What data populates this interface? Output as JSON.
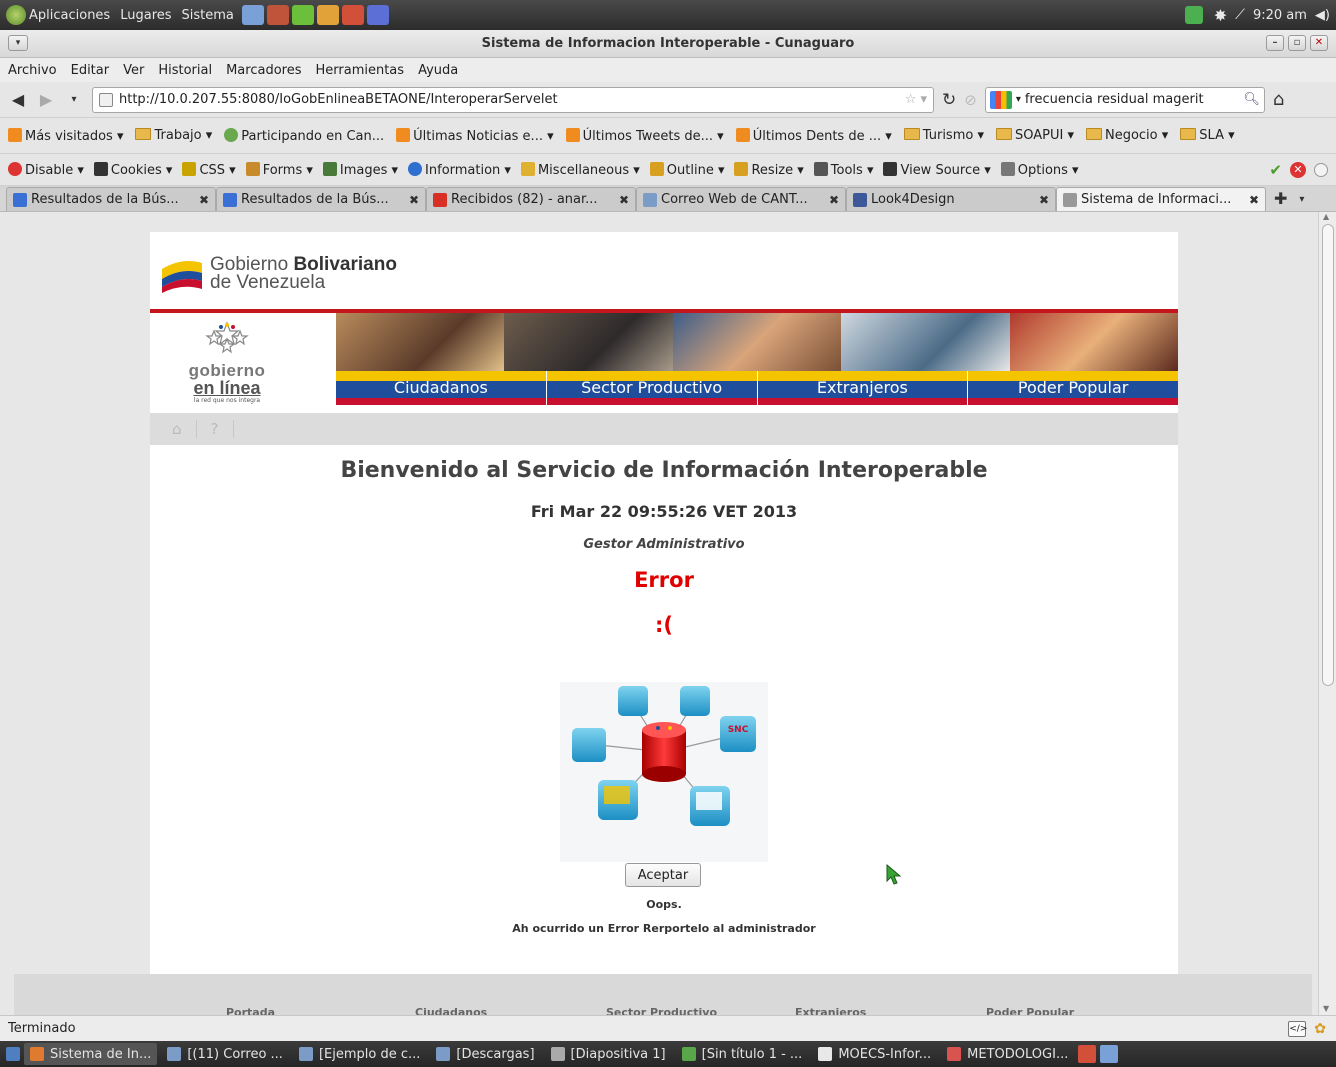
{
  "panel": {
    "menus": [
      "Aplicaciones",
      "Lugares",
      "Sistema"
    ],
    "clock": "9:20 am"
  },
  "window": {
    "title": "Sistema de Informacion Interoperable - Cunaguaro"
  },
  "menubar": [
    "Archivo",
    "Editar",
    "Ver",
    "Historial",
    "Marcadores",
    "Herramientas",
    "Ayuda"
  ],
  "navbar": {
    "url": "http://10.0.207.55:8080/IoGobEnlineaBETAONE/InteroperarServelet",
    "search": "frecuencia residual magerit"
  },
  "bookmarks": [
    {
      "label": "Más visitados ▾",
      "icon": "folder-icon"
    },
    {
      "label": "Trabajo ▾",
      "icon": "folder-icon"
    },
    {
      "label": "Participando en Can...",
      "icon": "favicon"
    },
    {
      "label": "Últimas Noticias e... ▾",
      "icon": "rss-icon"
    },
    {
      "label": "Últimos Tweets de... ▾",
      "icon": "rss-icon"
    },
    {
      "label": "Últimos Dents de ... ▾",
      "icon": "rss-icon"
    },
    {
      "label": "Turismo ▾",
      "icon": "folder-icon"
    },
    {
      "label": "SOAPUI ▾",
      "icon": "folder-icon"
    },
    {
      "label": "Negocio ▾",
      "icon": "folder-icon"
    },
    {
      "label": "SLA ▾",
      "icon": "folder-icon"
    }
  ],
  "devbar": [
    {
      "label": "Disable ▾",
      "color": "#d33"
    },
    {
      "label": "Cookies ▾",
      "color": "#333"
    },
    {
      "label": "CSS ▾",
      "color": "#c9a400"
    },
    {
      "label": "Forms ▾",
      "color": "#c98a2c"
    },
    {
      "label": "Images ▾",
      "color": "#4a7a3a"
    },
    {
      "label": "Information ▾",
      "color": "#2f6fcf"
    },
    {
      "label": "Miscellaneous ▾",
      "color": "#e0b030"
    },
    {
      "label": "Outline ▾",
      "color": "#d8a020"
    },
    {
      "label": "Resize ▾",
      "color": "#d8a020"
    },
    {
      "label": "Tools ▾",
      "color": "#555"
    },
    {
      "label": "View Source ▾",
      "color": "#333"
    },
    {
      "label": "Options ▾",
      "color": "#777"
    }
  ],
  "tabs": [
    {
      "label": "Resultados de la Bús...",
      "icon_color": "#3a6fd6"
    },
    {
      "label": "Resultados de la Bús...",
      "icon_color": "#3a6fd6"
    },
    {
      "label": "Recibidos (82) - anar...",
      "icon_color": "#d93025"
    },
    {
      "label": "Correo Web de CANT...",
      "icon_color": "#7a9cc6"
    },
    {
      "label": "Look4Design",
      "icon_color": "#3b5998"
    },
    {
      "label": "Sistema de Informaci...",
      "icon_color": "#999999"
    }
  ],
  "site": {
    "brand_line1_prefix": "Gobierno ",
    "brand_line1_bold": "Bolivariano",
    "brand_line2": "de Venezuela",
    "gel_line1": "gobierno",
    "gel_line2": "en línea",
    "gel_tagline": "la red que nos integra",
    "nav": [
      "Ciudadanos",
      "Sector Productivo",
      "Extranjeros",
      "Poder Popular"
    ],
    "welcome": "Bienvenido al Servicio de Información Interoperable",
    "datetime": "Fri Mar 22 09:55:26 VET 2013",
    "role": "Gestor Administrativo",
    "error_title": "Error",
    "error_face": ":(",
    "accept_label": "Aceptar",
    "oops": "Oops.",
    "error_message": "Ah ocurrido un Error Rerportelo al administrador",
    "network_badge": "SNC",
    "footer_links": [
      "Portada",
      "Ciudadanos",
      "Sector Productivo",
      "Extranieros",
      "Poder Popular"
    ]
  },
  "statusbar": {
    "text": "Terminado"
  },
  "taskbar": [
    {
      "label": "Sistema de In...",
      "active": true
    },
    {
      "label": "[(11) Correo ...",
      "active": false
    },
    {
      "label": "[Ejemplo de c...",
      "active": false
    },
    {
      "label": "[Descargas]",
      "active": false
    },
    {
      "label": "[Diapositiva 1]",
      "active": false
    },
    {
      "label": "[Sin título 1 - ...",
      "active": false
    },
    {
      "label": "MOECS-Infor...",
      "active": false
    },
    {
      "label": "METODOLOGI...",
      "active": false
    }
  ]
}
